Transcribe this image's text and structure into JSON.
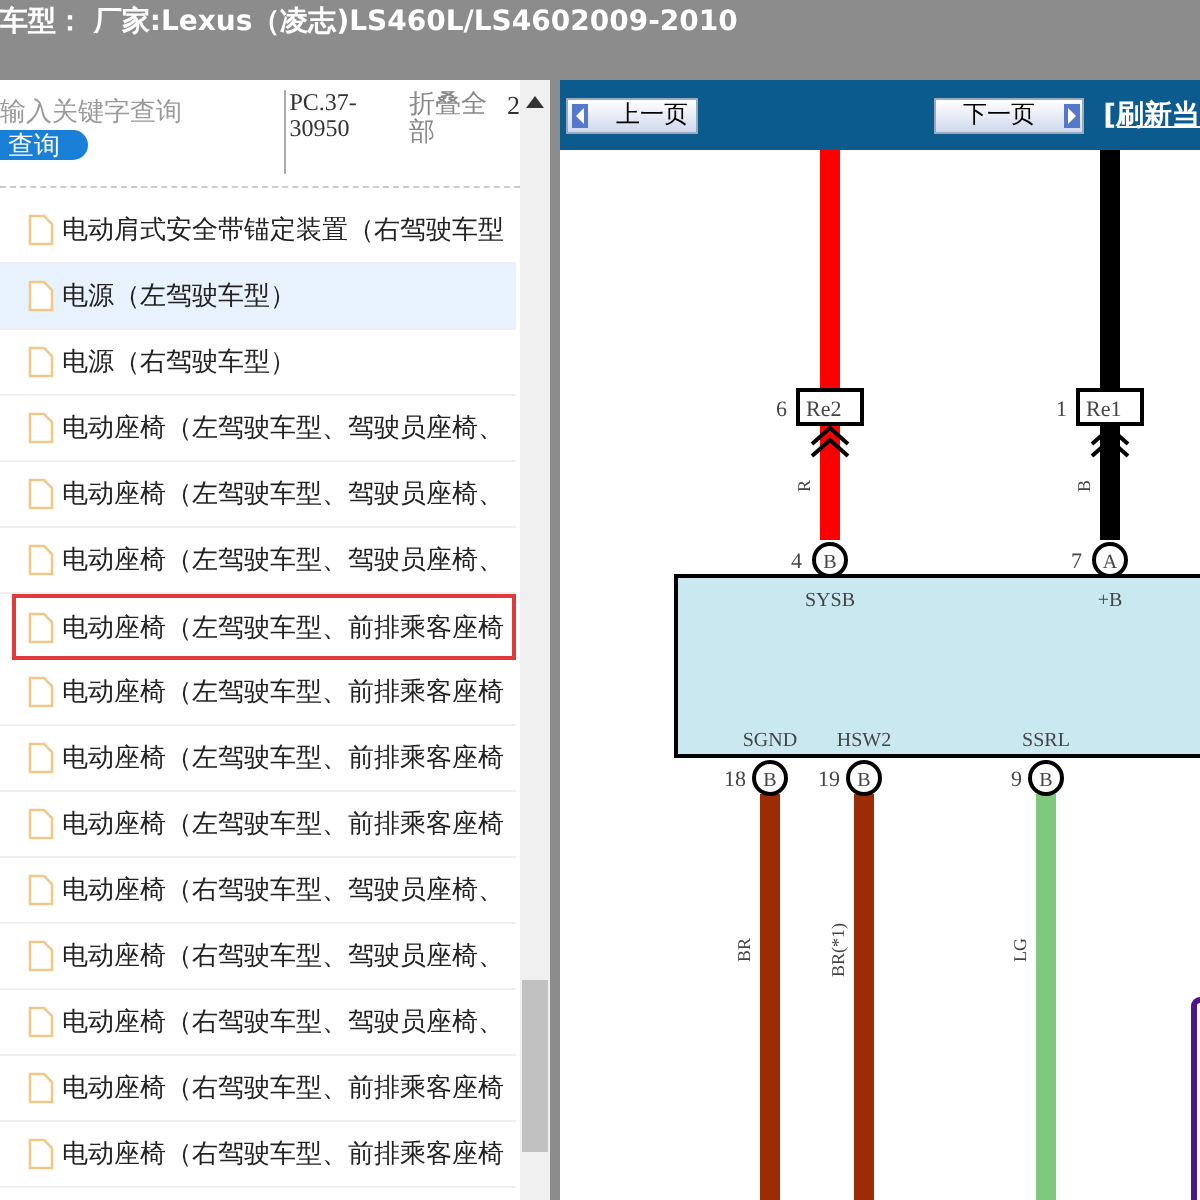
{
  "title_bar": {
    "title": "车型： 厂家:Lexus（凌志)LS460L/LS4602009-2010"
  },
  "search": {
    "placeholder": "输入关键字查询",
    "button": "查询",
    "code": "PC.37-30950",
    "collapse": "折叠全部",
    "page": "2"
  },
  "items": [
    {
      "label": "电动肩式安全带锚定装置（右驾驶车型",
      "selected": false,
      "outlined": false
    },
    {
      "label": "电源（左驾驶车型）",
      "selected": true,
      "outlined": false
    },
    {
      "label": "电源（右驾驶车型）",
      "selected": false,
      "outlined": false
    },
    {
      "label": "电动座椅（左驾驶车型、驾驶员座椅、",
      "selected": false,
      "outlined": false
    },
    {
      "label": "电动座椅（左驾驶车型、驾驶员座椅、",
      "selected": false,
      "outlined": false
    },
    {
      "label": "电动座椅（左驾驶车型、驾驶员座椅、",
      "selected": false,
      "outlined": false
    },
    {
      "label": "电动座椅（左驾驶车型、前排乘客座椅",
      "selected": false,
      "outlined": true
    },
    {
      "label": "电动座椅（左驾驶车型、前排乘客座椅",
      "selected": false,
      "outlined": false
    },
    {
      "label": "电动座椅（左驾驶车型、前排乘客座椅",
      "selected": false,
      "outlined": false
    },
    {
      "label": "电动座椅（左驾驶车型、前排乘客座椅",
      "selected": false,
      "outlined": false
    },
    {
      "label": "电动座椅（右驾驶车型、驾驶员座椅、",
      "selected": false,
      "outlined": false
    },
    {
      "label": "电动座椅（右驾驶车型、驾驶员座椅、",
      "selected": false,
      "outlined": false
    },
    {
      "label": "电动座椅（右驾驶车型、驾驶员座椅、",
      "selected": false,
      "outlined": false
    },
    {
      "label": "电动座椅（右驾驶车型、前排乘客座椅",
      "selected": false,
      "outlined": false
    },
    {
      "label": "电动座椅（右驾驶车型、前排乘客座椅",
      "selected": false,
      "outlined": false
    }
  ],
  "toolbar": {
    "prev": "上一页",
    "next": "下一页",
    "refresh": "[刷新当"
  },
  "diagram": {
    "top_pins": [
      {
        "number": "6",
        "terminal": "Re2",
        "wire": "R",
        "color": "#ff0000",
        "pin": "4",
        "connector": "B",
        "signal": "SYSB"
      },
      {
        "number": "1",
        "terminal": "Re1",
        "wire": "B",
        "color": "#000000",
        "pin": "7",
        "connector": "A",
        "signal": "+B"
      }
    ],
    "bottom_pins": [
      {
        "signal": "SGND",
        "pin": "18",
        "connector": "B",
        "wire": "BR",
        "color": "#9c2c06"
      },
      {
        "signal": "HSW2",
        "pin": "19",
        "connector": "B",
        "wire": "BR(*1)",
        "color": "#9c2c06"
      },
      {
        "signal": "SSRL",
        "pin": "9",
        "connector": "B",
        "wire": "LG",
        "color": "#7fc97f"
      }
    ]
  }
}
